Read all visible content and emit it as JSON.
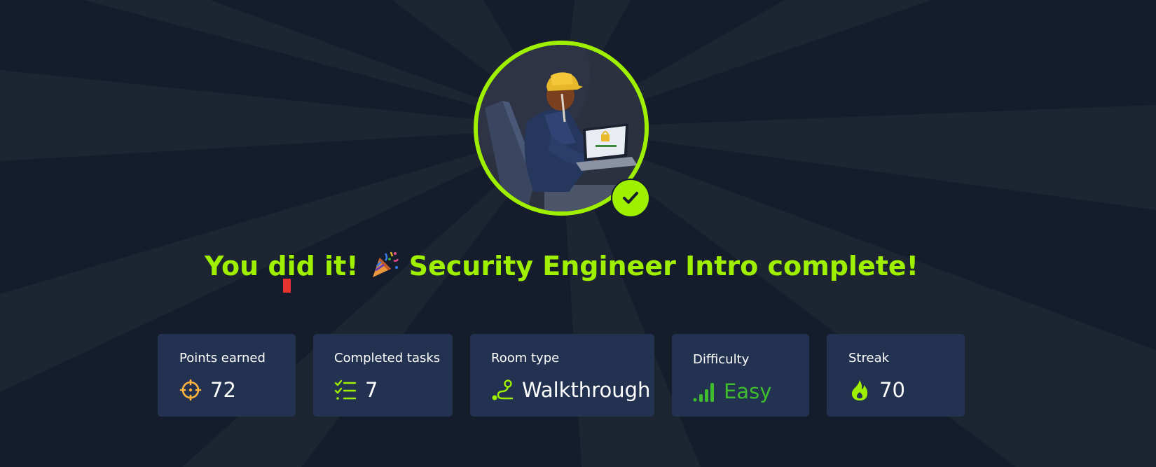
{
  "theme": {
    "background": "#151c2b",
    "accent": "#9fef00",
    "card_background": "#223250",
    "difficulty_color": "#3fbd2f",
    "icon_orange": "#ffb13e"
  },
  "hero": {
    "avatar_icon": "security-engineer-illustration",
    "badge_icon": "checkmark-icon"
  },
  "headline": {
    "prefix": "You did it!",
    "emoji_icon": "party-popper-icon",
    "suffix": "Security Engineer Intro complete!"
  },
  "stats": [
    {
      "label": "Points earned",
      "value": "72",
      "icon": "crosshair-icon"
    },
    {
      "label": "Completed tasks",
      "value": "7",
      "icon": "checklist-icon"
    },
    {
      "label": "Room type",
      "value": "Walkthrough",
      "icon": "route-icon"
    },
    {
      "label": "Difficulty",
      "value": "Easy",
      "icon": "signal-bars-icon"
    },
    {
      "label": "Streak",
      "value": "70",
      "icon": "flame-icon"
    }
  ]
}
